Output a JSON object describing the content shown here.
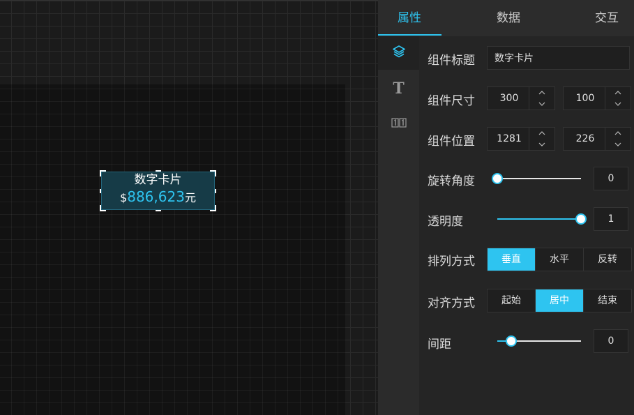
{
  "canvas": {
    "card": {
      "title": "数字卡片",
      "prefix": "$",
      "value": "886,623",
      "suffix": "元"
    }
  },
  "tabs": [
    {
      "label": "属性",
      "active": true
    },
    {
      "label": "数据",
      "active": false
    },
    {
      "label": "交互",
      "active": false
    }
  ],
  "side_rail": {
    "items": [
      {
        "icon": "layers-icon",
        "active": true
      },
      {
        "icon": "text-style-icon",
        "glyph": "T",
        "active": false
      },
      {
        "icon": "number-format-icon",
        "glyph": "11",
        "active": false
      }
    ]
  },
  "props": {
    "title": {
      "label": "组件标题",
      "value": "数字卡片"
    },
    "size": {
      "label": "组件尺寸",
      "width": "300",
      "height": "100"
    },
    "position": {
      "label": "组件位置",
      "x": "1281",
      "y": "226"
    },
    "rotation": {
      "label": "旋转角度",
      "value": "0",
      "fraction": 0
    },
    "opacity": {
      "label": "透明度",
      "value": "1",
      "fraction": 1
    },
    "arrangement": {
      "label": "排列方式",
      "options": [
        "垂直",
        "水平",
        "反转"
      ],
      "selected": 0
    },
    "alignment": {
      "label": "对齐方式",
      "options": [
        "起始",
        "居中",
        "结束"
      ],
      "selected": 1
    },
    "spacing": {
      "label": "间距",
      "value": "0",
      "fraction": 0.17
    }
  },
  "colors": {
    "accent": "#2ec4f0",
    "panel": "#252525",
    "canvas": "#1b1b1b"
  }
}
